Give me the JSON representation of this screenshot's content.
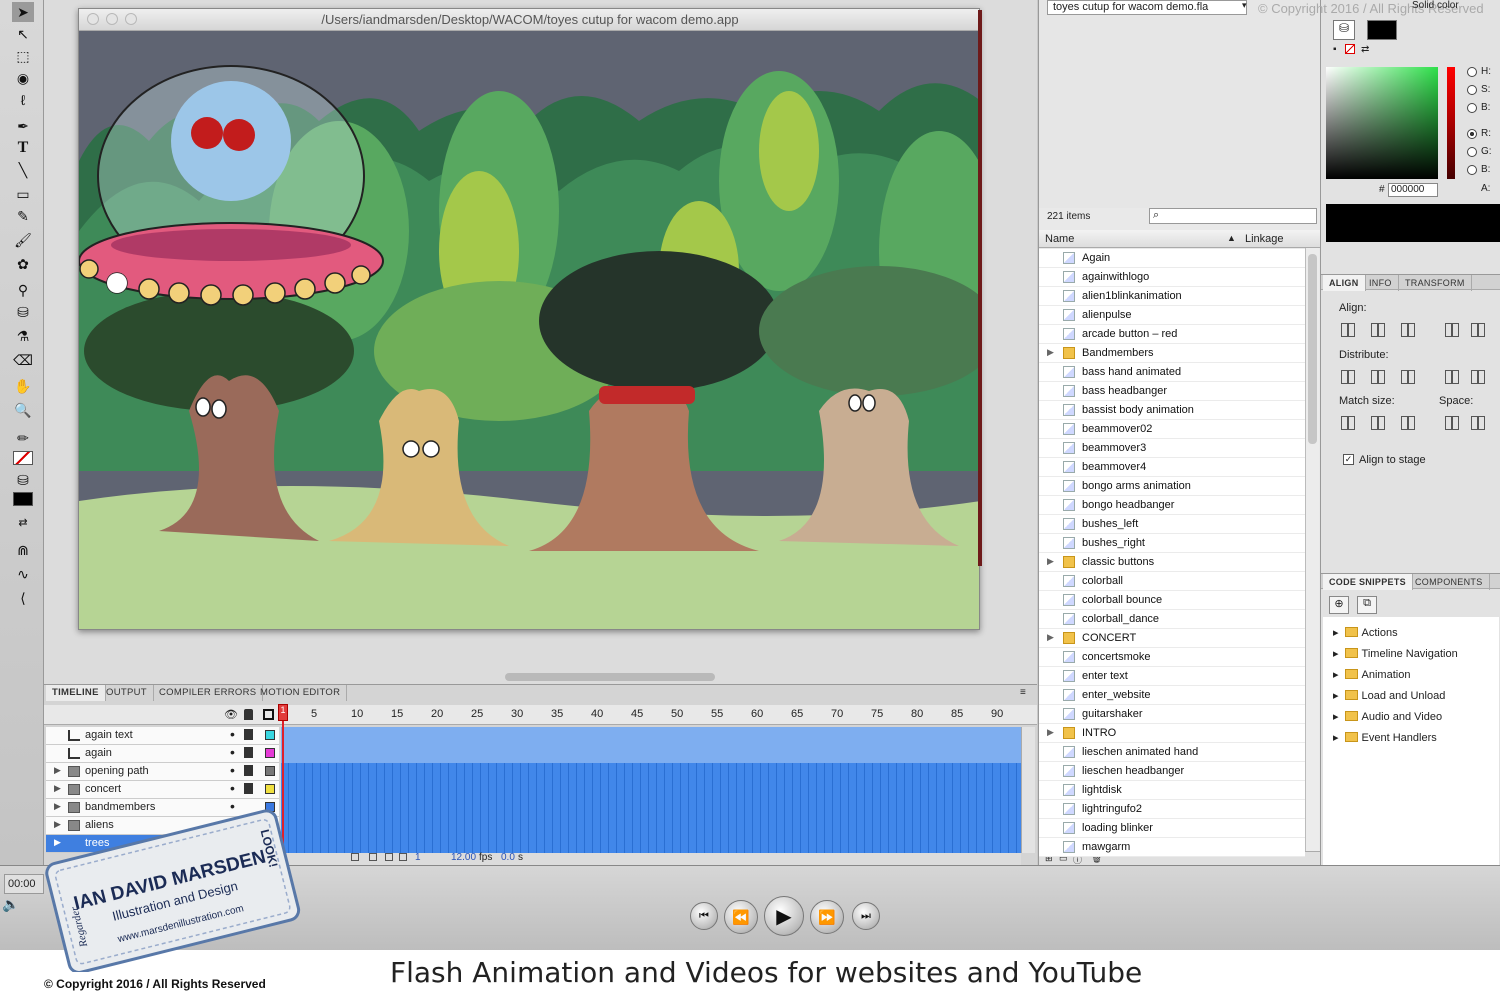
{
  "window": {
    "title": "/Users/iandmarsden/Desktop/WACOM/toyes cutup for wacom demo.app"
  },
  "library": {
    "document": "toyes cutup for wacom demo.fla",
    "count": "221 items",
    "col_name": "Name",
    "col_linkage": "Linkage",
    "items": [
      {
        "label": "Again",
        "type": "symbol"
      },
      {
        "label": "againwithlogo",
        "type": "symbol"
      },
      {
        "label": "alien1blinkanimation",
        "type": "symbol"
      },
      {
        "label": "alienpulse",
        "type": "symbol"
      },
      {
        "label": "arcade button – red",
        "type": "button"
      },
      {
        "label": "Bandmembers",
        "type": "folder"
      },
      {
        "label": "bass hand animated",
        "type": "symbol"
      },
      {
        "label": "bass headbanger",
        "type": "symbol"
      },
      {
        "label": "bassist body animation",
        "type": "symbol"
      },
      {
        "label": "beammover02",
        "type": "symbol"
      },
      {
        "label": "beammover3",
        "type": "symbol"
      },
      {
        "label": "beammover4",
        "type": "symbol"
      },
      {
        "label": "bongo arms animation",
        "type": "symbol"
      },
      {
        "label": "bongo headbanger",
        "type": "symbol"
      },
      {
        "label": "bushes_left",
        "type": "symbol"
      },
      {
        "label": "bushes_right",
        "type": "symbol"
      },
      {
        "label": "classic buttons",
        "type": "folder"
      },
      {
        "label": "colorball",
        "type": "symbol"
      },
      {
        "label": "colorball bounce",
        "type": "symbol"
      },
      {
        "label": "colorball_dance",
        "type": "symbol"
      },
      {
        "label": "CONCERT",
        "type": "folder"
      },
      {
        "label": "concertsmoke",
        "type": "symbol"
      },
      {
        "label": "enter text",
        "type": "symbol"
      },
      {
        "label": "enter_website",
        "type": "button"
      },
      {
        "label": "guitarshaker",
        "type": "symbol"
      },
      {
        "label": "INTRO",
        "type": "folder"
      },
      {
        "label": "lieschen animated hand",
        "type": "symbol"
      },
      {
        "label": "lieschen headbanger",
        "type": "symbol"
      },
      {
        "label": "lightdisk",
        "type": "symbol"
      },
      {
        "label": "lightringufo2",
        "type": "symbol"
      },
      {
        "label": "loading blinker",
        "type": "symbol"
      },
      {
        "label": "mawgarm",
        "type": "symbol"
      }
    ]
  },
  "timeline": {
    "tabs": [
      "TIMELINE",
      "OUTPUT",
      "COMPILER ERRORS",
      "MOTION EDITOR"
    ],
    "ruler": [
      "1",
      "5",
      "10",
      "15",
      "20",
      "25",
      "30",
      "35",
      "40",
      "45",
      "50",
      "55",
      "60",
      "65",
      "70",
      "75",
      "80",
      "85",
      "90"
    ],
    "layers": [
      {
        "name": "again text",
        "kind": "layer",
        "color": "#3ad6e0"
      },
      {
        "name": "again",
        "kind": "layer",
        "color": "#e53ad6"
      },
      {
        "name": "opening path",
        "kind": "folder",
        "color": "#777777"
      },
      {
        "name": "concert",
        "kind": "folder",
        "color": "#f0e040"
      },
      {
        "name": "bandmembers",
        "kind": "folder",
        "color": "#3a78e0"
      },
      {
        "name": "aliens",
        "kind": "folder",
        "color": ""
      },
      {
        "name": "trees",
        "kind": "folder",
        "color": ""
      }
    ],
    "current_frame": "1",
    "fps": "12.00",
    "fps_unit": "fps",
    "time": "0.0",
    "time_unit": "s"
  },
  "color_panel": {
    "title": "Solid color",
    "hex_prefix": "#",
    "hex": "000000",
    "modes": [
      "H:",
      "S:",
      "B:",
      "R:",
      "G:",
      "B:",
      "A:"
    ]
  },
  "align_panel": {
    "tabs": [
      "ALIGN",
      "INFO",
      "TRANSFORM"
    ],
    "align_label": "Align:",
    "distribute_label": "Distribute:",
    "match_size_label": "Match size:",
    "space_label": "Space:",
    "align_to_stage": "Align to stage"
  },
  "snippets_panel": {
    "tabs": [
      "CODE SNIPPETS",
      "COMPONENTS"
    ],
    "items": [
      "Actions",
      "Timeline Navigation",
      "Animation",
      "Load and Unload",
      "Audio and Video",
      "Event Handlers"
    ]
  },
  "player": {
    "time": "00:00"
  },
  "overlay": {
    "top_copyright": "© Copyright 2016 / All Rights Reserved",
    "caption": "Flash Animation and Videos for websites and YouTube",
    "copyright": "© Copyright 2016 / All Rights Reserved",
    "badge_name": "IAN DAVID MARSDEN",
    "badge_sub": "Illustration and Design",
    "badge_url": "www.marsdenillustration.com",
    "badge_left": "Regarder",
    "badge_right": "LOOK!"
  },
  "colors": {
    "frames": "#2f74dc",
    "playhead": "#e0202a",
    "stage_sky": "#5f6472",
    "stage_ground": "#b6d494"
  }
}
